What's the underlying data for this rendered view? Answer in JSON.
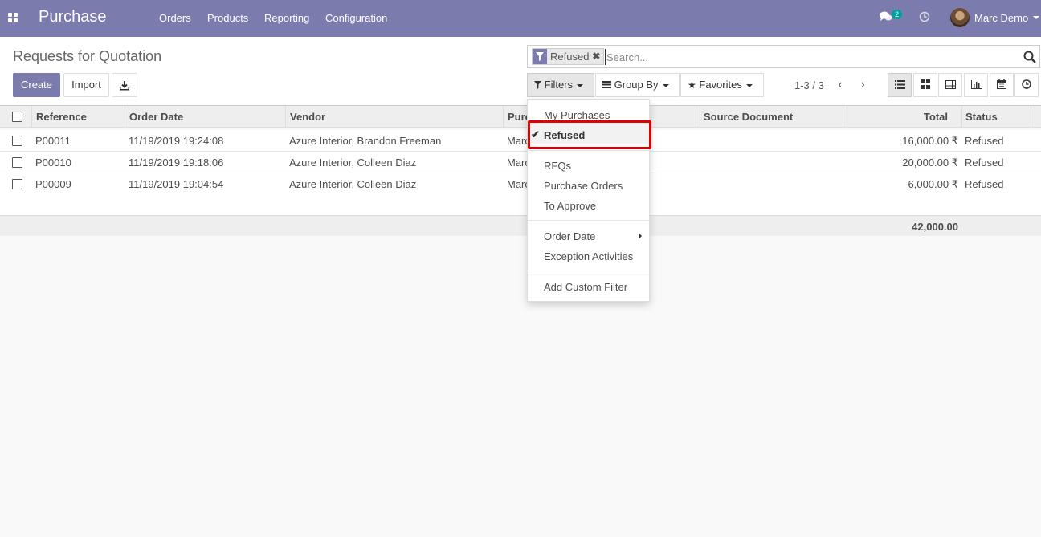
{
  "navbar": {
    "app_name": "Purchase",
    "menu": [
      "Orders",
      "Products",
      "Reporting",
      "Configuration"
    ],
    "message_count": "2",
    "user_name": "Marc Demo",
    "color": "#7c7bad"
  },
  "control_panel": {
    "title": "Requests for Quotation",
    "create_label": "Create",
    "import_label": "Import",
    "download_icon": "download-icon",
    "search": {
      "facet_label": "Refused",
      "facet_icon": "filter-icon",
      "placeholder": "Search..."
    },
    "filters_label": "Filters",
    "group_by_label": "Group By",
    "favorites_label": "Favorites",
    "pager": "1-3 / 3",
    "views": [
      "list-view-icon",
      "kanban-view-icon",
      "pivot-view-icon",
      "graph-view-icon",
      "calendar-view-icon",
      "activity-view-icon"
    ]
  },
  "table": {
    "columns": [
      "Reference",
      "Order Date",
      "Vendor",
      "Purc",
      "Source Document",
      "Total",
      "Status"
    ],
    "rows": [
      {
        "reference": "P00011",
        "order_date": "11/19/2019 19:24:08",
        "vendor": "Azure Interior, Brandon Freeman",
        "purchase_rep": "Marc",
        "total": "16,000.00 ₹",
        "status": "Refused"
      },
      {
        "reference": "P00010",
        "order_date": "11/19/2019 19:18:06",
        "vendor": "Azure Interior, Colleen Diaz",
        "purchase_rep": "Marc",
        "total": "20,000.00 ₹",
        "status": "Refused"
      },
      {
        "reference": "P00009",
        "order_date": "11/19/2019 19:04:54",
        "vendor": "Azure Interior, Colleen Diaz",
        "purchase_rep": "Marc",
        "total": "6,000.00 ₹",
        "status": "Refused"
      }
    ],
    "sum_total": "42,000.00"
  },
  "filters_dropdown": {
    "group1": [
      "My Purchases",
      "Refused"
    ],
    "group2": [
      "RFQs",
      "Purchase Orders",
      "To Approve"
    ],
    "group3": [
      "Order Date",
      "Exception Activities"
    ],
    "add_custom": "Add Custom Filter",
    "selected": "Refused",
    "highlight_color": "#e00000"
  }
}
